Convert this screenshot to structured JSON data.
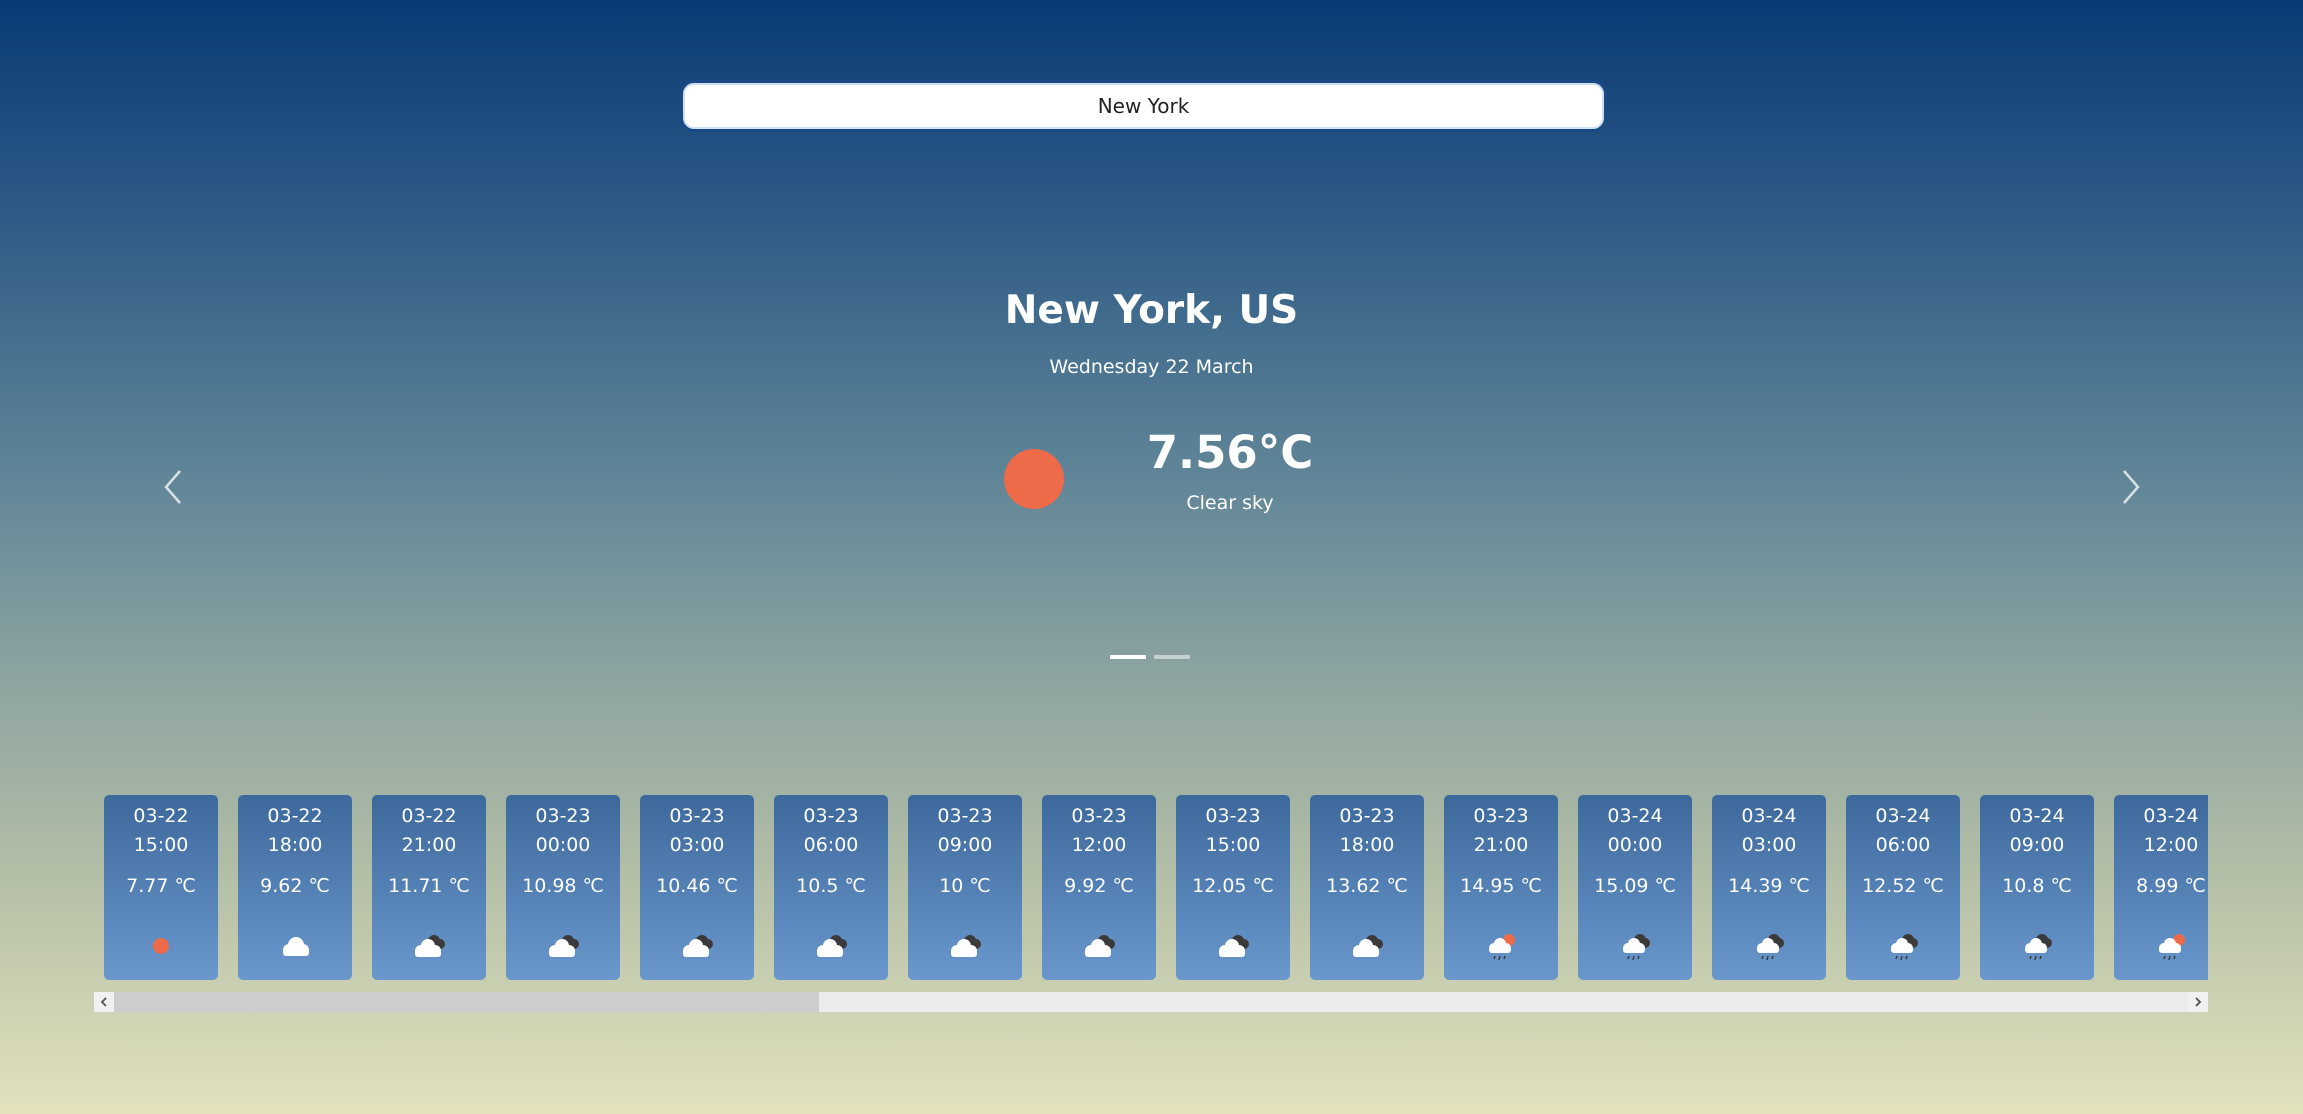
{
  "search": {
    "value": "New York"
  },
  "current": {
    "location": "New York, US",
    "date": "Wednesday 22 March",
    "temperature": "7.56°C",
    "condition": "Clear sky",
    "icon": "sun-icon"
  },
  "carousel": {
    "prev_icon": "chevron-left-icon",
    "next_icon": "chevron-right-icon",
    "indicators": 2,
    "active_indicator": 0
  },
  "forecast": [
    {
      "date": "03-22",
      "time": "15:00",
      "temp": "7.77 ℃",
      "icon": "sun-icon"
    },
    {
      "date": "03-22",
      "time": "18:00",
      "temp": "9.62 ℃",
      "icon": "cloud-icon"
    },
    {
      "date": "03-22",
      "time": "21:00",
      "temp": "11.71 ℃",
      "icon": "broken-clouds-icon"
    },
    {
      "date": "03-23",
      "time": "00:00",
      "temp": "10.98 ℃",
      "icon": "broken-clouds-icon"
    },
    {
      "date": "03-23",
      "time": "03:00",
      "temp": "10.46 ℃",
      "icon": "broken-clouds-icon"
    },
    {
      "date": "03-23",
      "time": "06:00",
      "temp": "10.5 ℃",
      "icon": "broken-clouds-icon"
    },
    {
      "date": "03-23",
      "time": "09:00",
      "temp": "10 ℃",
      "icon": "broken-clouds-icon"
    },
    {
      "date": "03-23",
      "time": "12:00",
      "temp": "9.92 ℃",
      "icon": "broken-clouds-icon"
    },
    {
      "date": "03-23",
      "time": "15:00",
      "temp": "12.05 ℃",
      "icon": "broken-clouds-icon"
    },
    {
      "date": "03-23",
      "time": "18:00",
      "temp": "13.62 ℃",
      "icon": "broken-clouds-icon"
    },
    {
      "date": "03-23",
      "time": "21:00",
      "temp": "14.95 ℃",
      "icon": "sun-rain-icon"
    },
    {
      "date": "03-24",
      "time": "00:00",
      "temp": "15.09 ℃",
      "icon": "rain-icon"
    },
    {
      "date": "03-24",
      "time": "03:00",
      "temp": "14.39 ℃",
      "icon": "rain-icon"
    },
    {
      "date": "03-24",
      "time": "06:00",
      "temp": "12.52 ℃",
      "icon": "rain-icon"
    },
    {
      "date": "03-24",
      "time": "09:00",
      "temp": "10.8 ℃",
      "icon": "rain-icon"
    },
    {
      "date": "03-24",
      "time": "12:00",
      "temp": "8.99 ℃",
      "icon": "sun-rain-icon"
    }
  ],
  "scroll": {
    "visible_fraction": 0.34,
    "position_fraction": 0
  },
  "colors": {
    "sun": "#ed6b49",
    "card_top": "#3d689c",
    "card_bottom": "#6a98cc",
    "dark_cloud": "#3a3a3a",
    "light_cloud": "#ffffff",
    "rain": "#3a3a3a"
  }
}
